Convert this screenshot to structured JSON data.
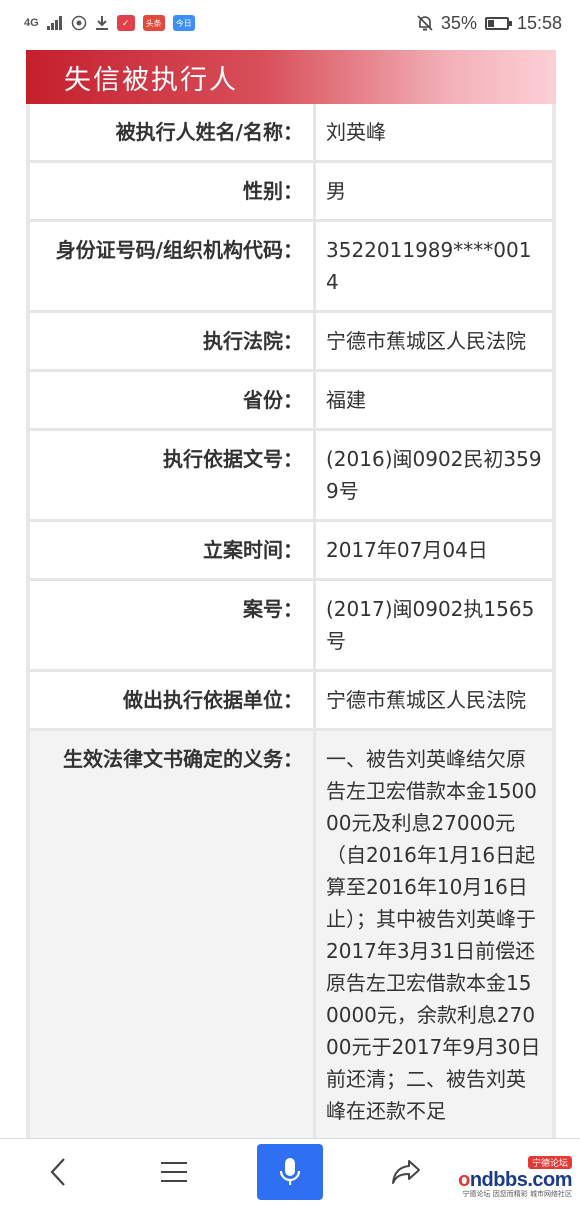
{
  "statusbar": {
    "network": "4G",
    "battery": "35%",
    "battery_level": 0.35,
    "time": "15:58",
    "badge1": "头条",
    "badge2": "今日"
  },
  "header": {
    "title": "失信被执行人"
  },
  "rows": [
    {
      "key": "被执行人姓名/名称：",
      "value": "刘英峰"
    },
    {
      "key": "性别：",
      "value": "男"
    },
    {
      "key": "身份证号码/组织机构代码：",
      "value": "3522011989****0014"
    },
    {
      "key": "执行法院：",
      "value": "宁德市蕉城区人民法院"
    },
    {
      "key": "省份：",
      "value": "福建"
    },
    {
      "key": "执行依据文号：",
      "value": "(2016)闽0902民初3599号"
    },
    {
      "key": "立案时间：",
      "value": "2017年07月04日"
    },
    {
      "key": "案号：",
      "value": "(2017)闽0902执1565号"
    },
    {
      "key": "做出执行依据单位：",
      "value": "宁德市蕉城区人民法院"
    },
    {
      "key": "生效法律文书确定的义务：",
      "value": "一、被告刘英峰结欠原告左卫宏借款本金150000元及利息27000元（自2016年1月16日起算至2016年10月16日止）；其中被告刘英峰于2017年3月31日前偿还原告左卫宏借款本金150000元，余款利息27000元于2017年9月30日前还清；二、被告刘英峰在还款不足"
    }
  ],
  "nav": {
    "back": "back-icon",
    "menu": "menu-icon",
    "voice": "microphone-icon",
    "share": "share-icon"
  },
  "watermark": {
    "top": "宁德论坛",
    "main_o": "o",
    "main_rest": "ndbbs.com",
    "sub": "宁德论坛 因您而精彩 城市网络社区"
  }
}
